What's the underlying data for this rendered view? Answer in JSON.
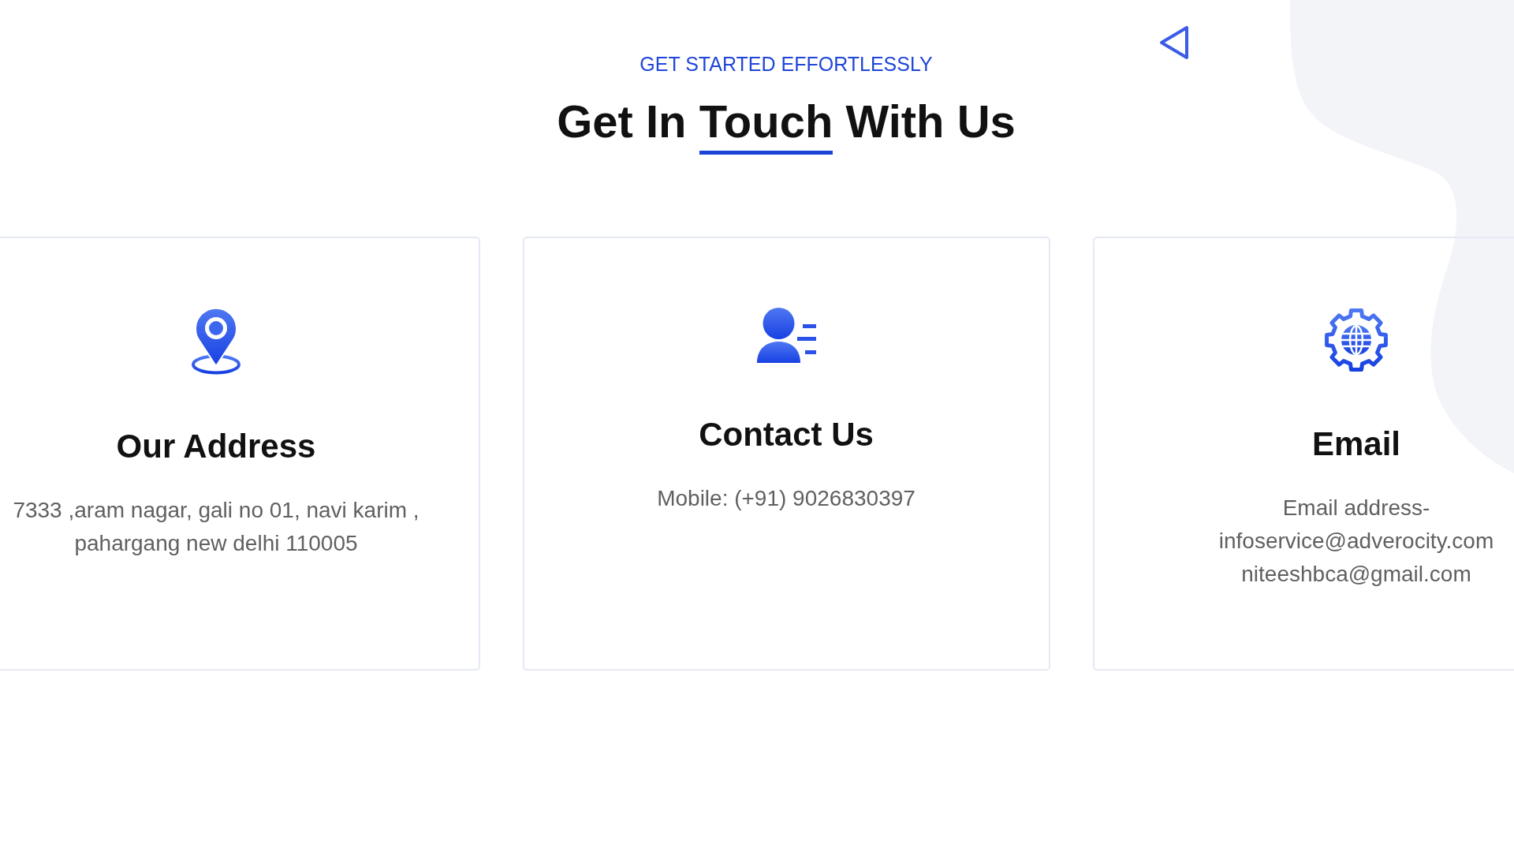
{
  "header": {
    "eyebrow": "GET STARTED EFFORTLESSLY",
    "title": [
      {
        "text": "Get In",
        "underlined": false
      },
      {
        "text": "Touch",
        "underlined": true
      },
      {
        "text": "With Us",
        "underlined": false
      }
    ]
  },
  "cards": [
    {
      "kind": "address",
      "title": "Our Address",
      "text": "7333 ,aram nagar, gali no 01, navi karim , pahargang new delhi 110005"
    },
    {
      "kind": "phone",
      "title": "Contact Us",
      "text": "Mobile: (+91) 9026830397"
    },
    {
      "kind": "email",
      "title": "Email",
      "text": "Email address- infoservice@adverocity.com niteeshbca@gmail.com"
    }
  ]
}
